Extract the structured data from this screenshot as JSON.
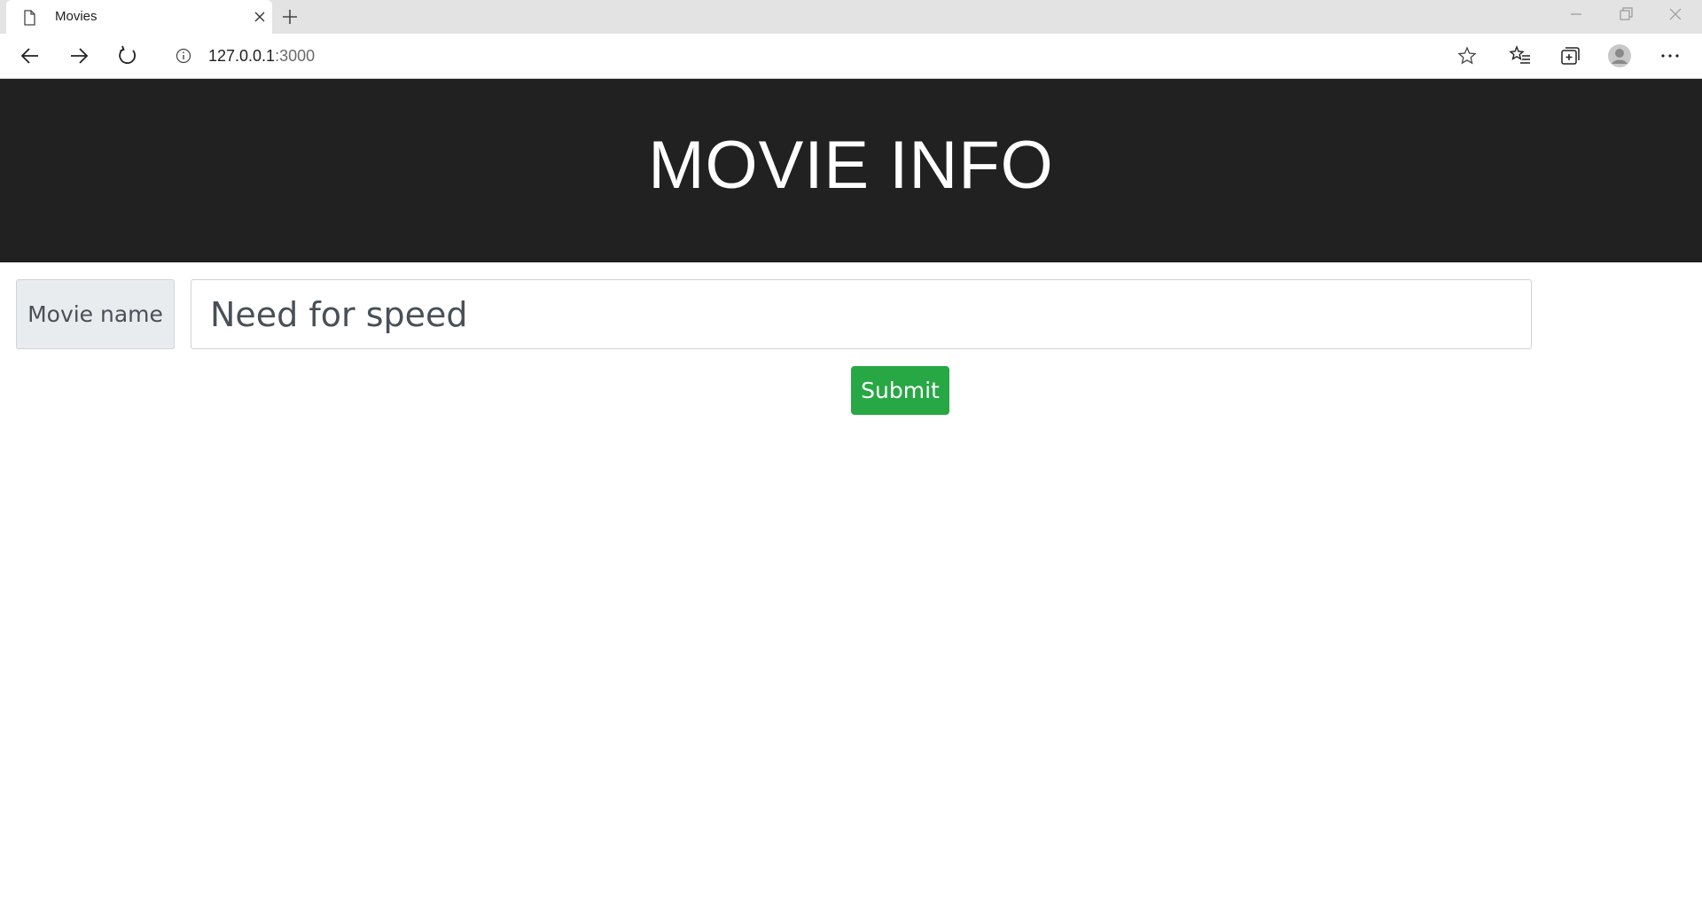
{
  "browser": {
    "tab_title": "Movies",
    "url_host": "127.0.0.1",
    "url_port": ":3000",
    "icons": {
      "tab": "page-icon",
      "close_tab": "close-icon",
      "new_tab": "plus-icon",
      "back": "arrow-left-icon",
      "forward": "arrow-right-icon",
      "reload": "reload-icon",
      "info": "info-icon",
      "favorite": "star-icon",
      "favorites": "favorites-icon",
      "collections": "collections-icon",
      "profile": "profile-icon",
      "more": "more-icon"
    }
  },
  "page": {
    "header_title": "MOVIE INFO",
    "input_label": "Movie name",
    "input_value": "Need for speed",
    "submit_label": "Submit"
  },
  "colors": {
    "header_bg": "#212121",
    "submit_bg": "#28a745",
    "label_bg": "#e9ecef"
  }
}
